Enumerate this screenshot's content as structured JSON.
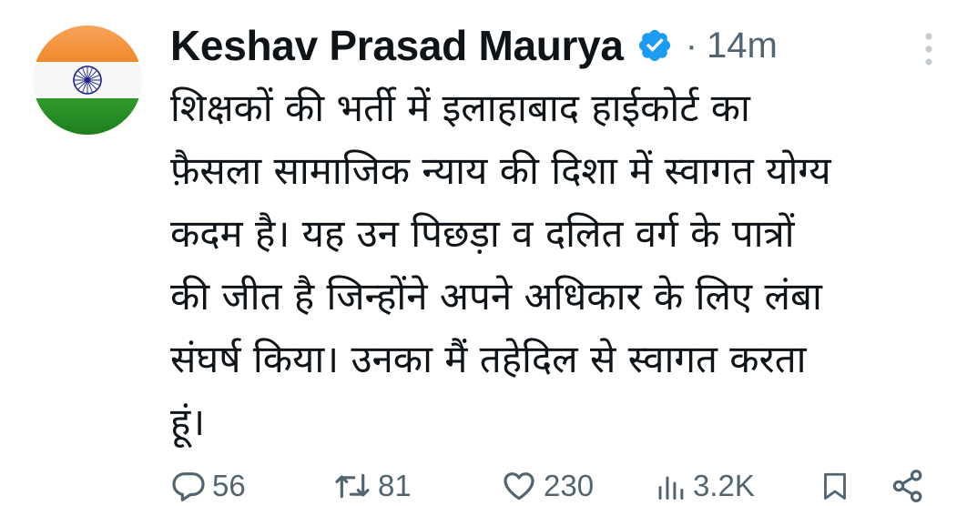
{
  "author": {
    "display_name": "Keshav Prasad Maurya",
    "verified": true,
    "separator": "·",
    "timestamp": "14m",
    "avatar": "indian-flag-avatar"
  },
  "tweet": {
    "lines": [
      "शिक्षकों की भर्ती में इलाहाबाद हाईकोर्ट का",
      "फ़ैसला सामाजिक न्याय की दिशा में स्वागत योग्य",
      "कदम है। यह उन पिछड़ा व दलित वर्ग के पात्रों",
      "की जीत है जिन्होंने अपने अधिकार के लिए लंबा",
      "संघर्ष किया। उनका मैं तहेदिल से स्वागत करता",
      "हूं।"
    ]
  },
  "actions": {
    "replies": "56",
    "reposts": "81",
    "likes": "230",
    "views": "3.2K"
  },
  "icons": {
    "reply": "reply-icon",
    "repost": "repost-icon",
    "like": "heart-icon",
    "views": "views-icon",
    "bookmark": "bookmark-icon",
    "share": "share-icon",
    "more": "more-vertical-icon",
    "verified": "verified-badge-icon"
  },
  "colors": {
    "text": "#0f1419",
    "secondary": "#536471",
    "verified": "#1d9bf0",
    "saffron": "#FF9933",
    "green": "#138808",
    "chakra": "#000080"
  }
}
